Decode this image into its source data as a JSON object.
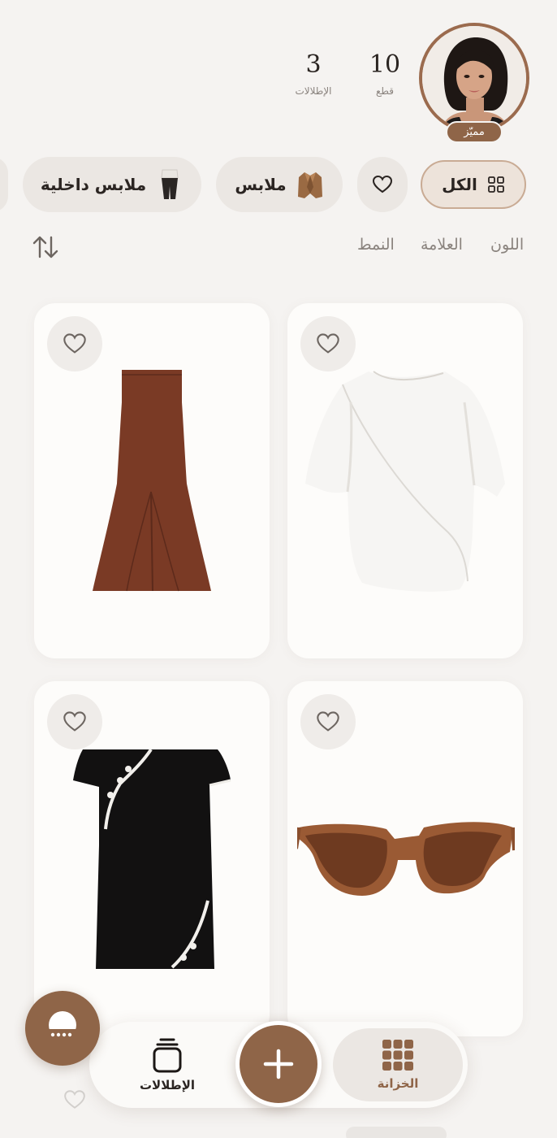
{
  "profile": {
    "badge": "مميّز",
    "stats": [
      {
        "value": "10",
        "label": "قطع"
      },
      {
        "value": "3",
        "label": "الإطلالات"
      }
    ]
  },
  "categories": [
    {
      "label": "الكل",
      "icon": "grid-icon",
      "active": true
    },
    {
      "label": "",
      "icon": "heart-icon",
      "active": false
    },
    {
      "label": "ملابس",
      "icon": "jacket-thumbnail",
      "active": false
    },
    {
      "label": "ملابس داخلية",
      "icon": "underwear-thumbnail",
      "active": false
    }
  ],
  "filters": {
    "color": "اللون",
    "brand": "العلامة",
    "style": "النمط"
  },
  "items": [
    {
      "kind": "white-draped-top"
    },
    {
      "kind": "brown-maxi-dress"
    },
    {
      "kind": "brown-cat-eye-sunglasses"
    },
    {
      "kind": "black-mini-dress"
    }
  ],
  "nav": {
    "wardrobe": "الخزانة",
    "looks": "الإطلالات",
    "add": "add-icon"
  },
  "colors": {
    "accent": "#8f6548",
    "background": "#f5f3f1",
    "card": "#fdfcfa"
  }
}
